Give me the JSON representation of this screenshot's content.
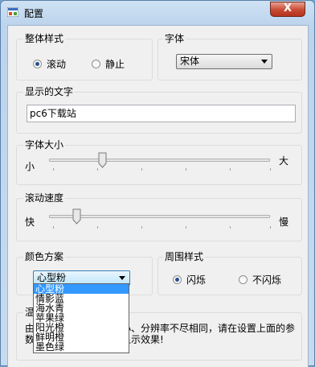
{
  "window": {
    "title": "配置",
    "close_symbol": "X"
  },
  "style_group": {
    "label": "整体样式",
    "options": [
      {
        "label": "滚动",
        "checked": true
      },
      {
        "label": "静止",
        "checked": false
      }
    ]
  },
  "font_group": {
    "label": "字体",
    "selected": "宋体"
  },
  "display_text_group": {
    "label": "显示的文字",
    "value": "pc6下载站"
  },
  "font_size_group": {
    "label": "字体大小",
    "min_label": "小",
    "max_label": "大",
    "level": 0.35
  },
  "scroll_speed_group": {
    "label": "滚动速度",
    "min_label": "快",
    "max_label": "慢",
    "level": 0.1
  },
  "color_group": {
    "label": "颜色方案",
    "selected": "心型粉",
    "options": [
      "心型粉",
      "情影蓝",
      "海水青",
      "苹果绿",
      "阳光橙",
      "鲜明橙",
      "墨色绿"
    ]
  },
  "border_group": {
    "label": "周围样式",
    "options": [
      {
        "label": "闪烁",
        "checked": true
      },
      {
        "label": "不闪烁",
        "checked": false
      }
    ]
  },
  "tip_group": {
    "label": "温",
    "text": "由于每台电脑的屏幕大小、分辨率不尽相同，请在设置上面的参数时调整，以达到最佳显示效果!"
  },
  "colors": {
    "selection": "#3399ff",
    "radio_dot": "#2a4f90",
    "close_button": "#c74a33"
  }
}
